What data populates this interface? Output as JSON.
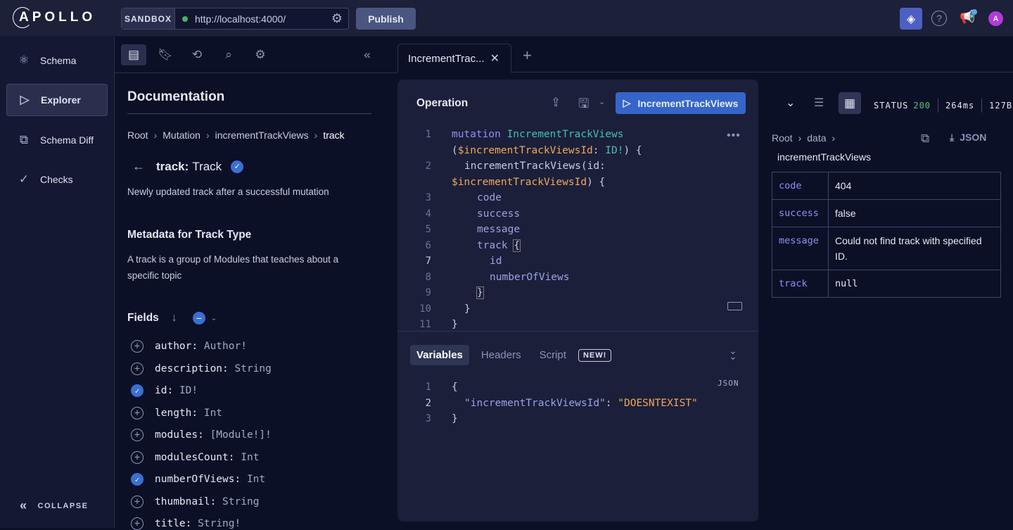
{
  "topbar": {
    "logo": "APOLLO",
    "sandbox_label": "SANDBOX",
    "endpoint_url": "http://localhost:4000/",
    "publish_label": "Publish",
    "connection_status_color": "#4caf63",
    "avatar_letter": "A"
  },
  "leftnav": {
    "items": [
      {
        "label": "Schema",
        "icon": "schema-graph-icon"
      },
      {
        "label": "Explorer",
        "icon": "play-icon",
        "active": true
      },
      {
        "label": "Schema Diff",
        "icon": "diff-icon"
      },
      {
        "label": "Checks",
        "icon": "check-icon"
      }
    ],
    "collapse_label": "COLLAPSE"
  },
  "docs": {
    "title": "Documentation",
    "breadcrumb": [
      "Root",
      "Mutation",
      "incrementTrackViews",
      "track"
    ],
    "field_name": "track:",
    "field_type": "Track",
    "field_description": "Newly updated track after a successful mutation",
    "metadata_title": "Metadata for Track Type",
    "metadata_description": "A track is a group of Modules that teaches about a specific topic",
    "fields_label": "Fields",
    "fields": [
      {
        "name": "author:",
        "type": "Author!",
        "selected": false
      },
      {
        "name": "description:",
        "type": "String",
        "selected": false
      },
      {
        "name": "id:",
        "type": "ID!",
        "selected": true
      },
      {
        "name": "length:",
        "type": "Int",
        "selected": false
      },
      {
        "name": "modules:",
        "type": "[Module!]!",
        "selected": false
      },
      {
        "name": "modulesCount:",
        "type": "Int",
        "selected": false
      },
      {
        "name": "numberOfViews:",
        "type": "Int",
        "selected": true
      },
      {
        "name": "thumbnail:",
        "type": "String",
        "selected": false
      },
      {
        "name": "title:",
        "type": "String!",
        "selected": false
      }
    ]
  },
  "editor": {
    "tab_label": "IncrementTrac...",
    "operation_label": "Operation",
    "run_label": "IncrementTrackViews",
    "line_numbers": [
      "1",
      "2",
      "3",
      "4",
      "5",
      "6",
      "7",
      "8",
      "9",
      "10",
      "11"
    ],
    "code": {
      "l1a": "mutation",
      "l1b": "IncrementTrackViews",
      "l1c": "(",
      "l1d": "$incrementTrackViewsId",
      "l1e": ":",
      "l1f": "ID!",
      ")": ") {",
      "l1g": ") {",
      "l2a": "incrementTrackViews(id:",
      "l2b": "$incrementTrackViewsId",
      "l2c": ") {",
      "l3": "code",
      "l4": "success",
      "l5": "message",
      "l6": "track",
      "l6b": "{",
      "l7": "id",
      "l8": "numberOfViews",
      "l9": "}",
      "l10": "}",
      "l11": "}"
    },
    "var_tabs": [
      "Variables",
      "Headers",
      "Script"
    ],
    "new_badge": "NEW!",
    "json_label": "JSON",
    "var_lines": [
      "1",
      "2",
      "3"
    ],
    "var_open": "{",
    "var_key": "\"incrementTrackViewsId\"",
    "var_colon": ": ",
    "var_value": "\"DOESNTEXIST\"",
    "var_close": "}"
  },
  "response": {
    "status_label": "STATUS",
    "status_code": "200",
    "time": "264ms",
    "size": "127B",
    "status_color": "#5fbf7a",
    "breadcrumb": [
      "Root",
      "data",
      "incrementTrackViews"
    ],
    "json_label": "JSON",
    "rows": [
      {
        "key": "code",
        "value": "404"
      },
      {
        "key": "success",
        "value": "false"
      },
      {
        "key": "message",
        "value": "Could not find track with specified ID."
      },
      {
        "key": "track",
        "value": "null"
      }
    ]
  }
}
